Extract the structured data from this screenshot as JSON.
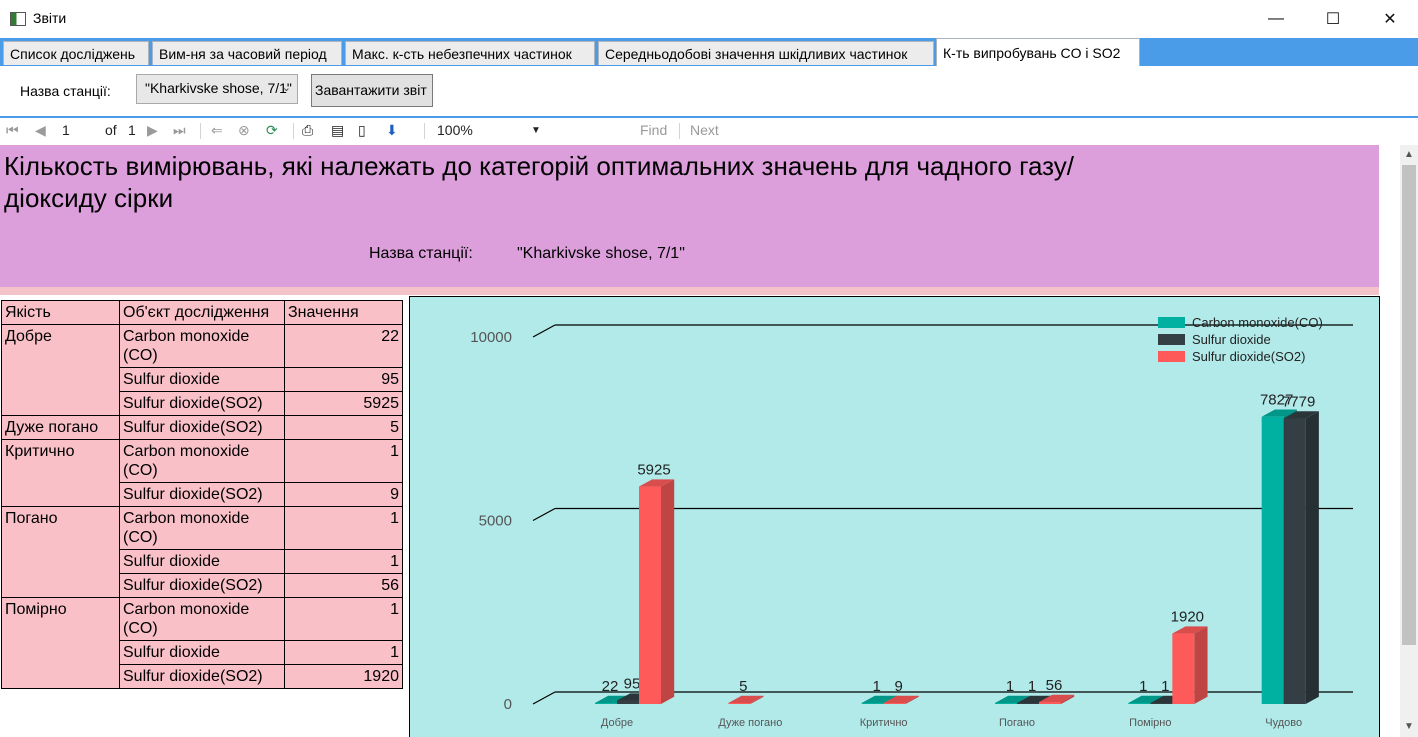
{
  "window": {
    "title": "Звіти",
    "minimize": "—",
    "maximize": "☐",
    "close": "✕"
  },
  "tabs": [
    "Список досліджень",
    "Вим-ня за часовий період",
    "Макс. к-сть небезпечних частинок",
    "Середньодобові значення шкідливих частинок",
    "К-ть випробувань CO і SO2"
  ],
  "params": {
    "station_label": "Назва станції:",
    "station_value": "\"Kharkivske shose, 7/1\"",
    "load_button": "Завантажити звіт"
  },
  "toolbar": {
    "page": "1",
    "of": "of",
    "total": "1",
    "zoom": "100%",
    "find": "Find",
    "next": "Next"
  },
  "report": {
    "title": "Кількость вимірювань, які належать до категорій оптимальних значень для чадного газу/діоксиду сірки",
    "station_label": "Назва станції:",
    "station_value": "\"Kharkivske shose, 7/1\"",
    "table": {
      "headers": [
        "Якість",
        "Об'єкт дослідження",
        "Значення"
      ],
      "groups": [
        {
          "quality": "Добре",
          "rows": [
            [
              "Carbon monoxide (CO)",
              "22"
            ],
            [
              "Sulfur dioxide",
              "95"
            ],
            [
              "Sulfur dioxide(SO2)",
              "5925"
            ]
          ]
        },
        {
          "quality": "Дуже погано",
          "rows": [
            [
              "Sulfur dioxide(SO2)",
              "5"
            ]
          ]
        },
        {
          "quality": "Критично",
          "rows": [
            [
              "Carbon monoxide (CO)",
              "1"
            ],
            [
              "Sulfur dioxide(SO2)",
              "9"
            ]
          ]
        },
        {
          "quality": "Погано",
          "rows": [
            [
              "Carbon monoxide (CO)",
              "1"
            ],
            [
              "Sulfur dioxide",
              "1"
            ],
            [
              "Sulfur dioxide(SO2)",
              "56"
            ]
          ]
        },
        {
          "quality": "Помірно",
          "rows": [
            [
              "Carbon monoxide (CO)",
              "1"
            ],
            [
              "Sulfur dioxide",
              "1"
            ],
            [
              "Sulfur dioxide(SO2)",
              "1920"
            ]
          ]
        }
      ]
    }
  },
  "chart_data": {
    "type": "bar",
    "categories": [
      "Добре",
      "Дуже погано",
      "Критично",
      "Погано",
      "Помірно",
      "Чудово"
    ],
    "series": [
      {
        "name": "Carbon monoxide(CO)",
        "color": "#00b0a0",
        "values": [
          22,
          null,
          1,
          1,
          1,
          7827
        ]
      },
      {
        "name": "Sulfur dioxide",
        "color": "#333f44",
        "values": [
          95,
          null,
          null,
          1,
          1,
          7779
        ]
      },
      {
        "name": "Sulfur dioxide(SO2)",
        "color": "#ff5a5a",
        "values": [
          5925,
          5,
          9,
          56,
          1920,
          null
        ]
      }
    ],
    "yticks": [
      0,
      5000,
      10000
    ],
    "ylim": [
      0,
      10000
    ],
    "legend": "top-right"
  }
}
